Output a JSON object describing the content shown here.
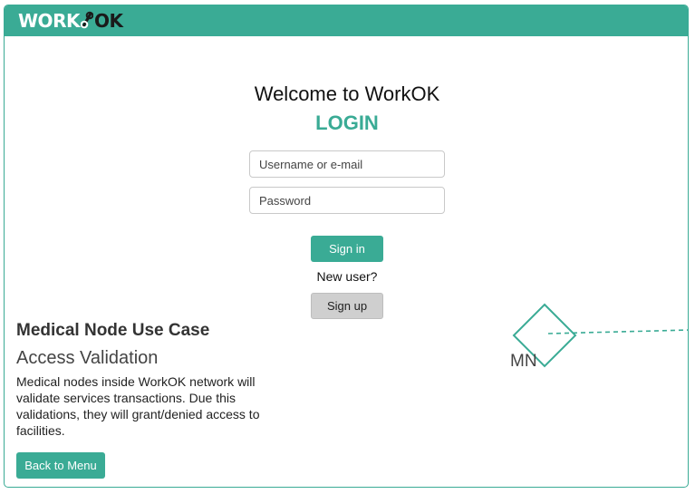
{
  "header": {
    "logo_left": "WORK",
    "logo_right": "OK"
  },
  "login": {
    "welcome": "Welcome to WorkOK",
    "title": "LOGIN",
    "username_placeholder": "Username or e-mail",
    "password_placeholder": "Password",
    "signin_label": "Sign in",
    "new_user_text": "New user?",
    "signup_label": "Sign up"
  },
  "use_case": {
    "title": "Medical Node Use Case",
    "subtitle": "Access Validation",
    "description": "Medical nodes inside WorkOK network will validate services transactions. Due this validations, they will grant/denied access to facilities.",
    "back_label": "Back to Menu"
  },
  "diagram": {
    "node_label": "MN",
    "node_icon": "diamond-node-icon"
  },
  "colors": {
    "accent": "#3aab95",
    "secondary_button": "#cfcfcf"
  }
}
